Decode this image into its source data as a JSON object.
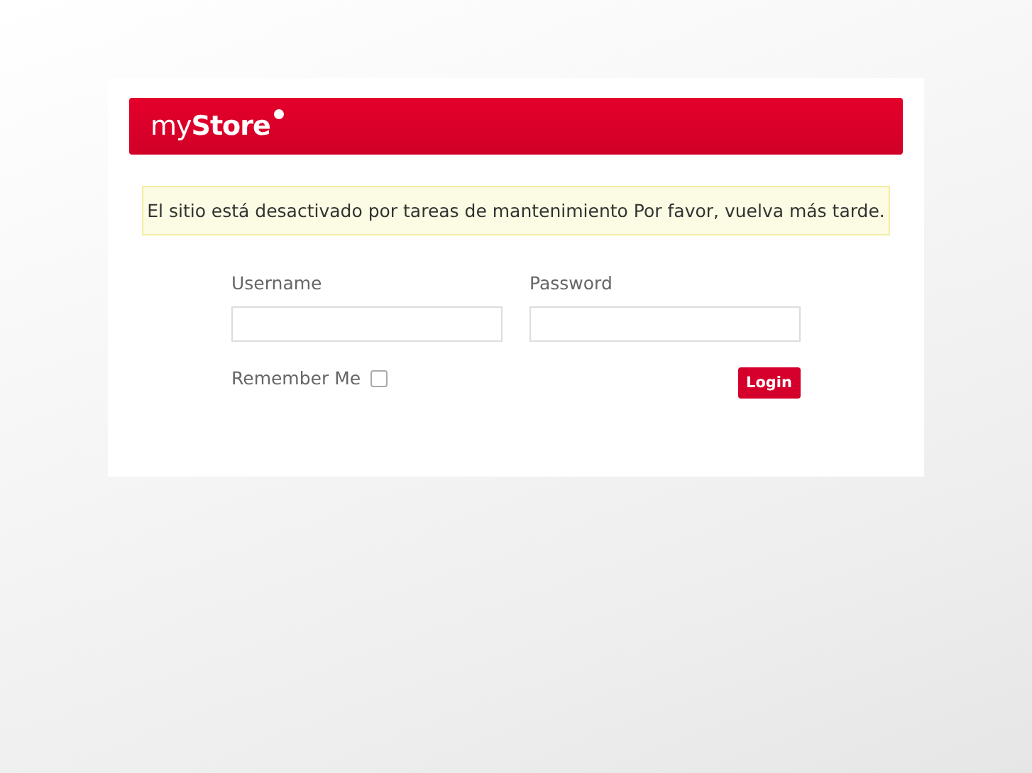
{
  "logo": "my**Store**",
  "notice": "El sitio está desactivado por tareas de mantenimiento Por favor, vuelva más tarde.",
  "fields": [
    {
      "label": "Username"
    },
    {
      "label": "Password"
    }
  ],
  "remember": {
    "label": "Remember Me",
    "checked": false
  },
  "login_button": "Login"
}
